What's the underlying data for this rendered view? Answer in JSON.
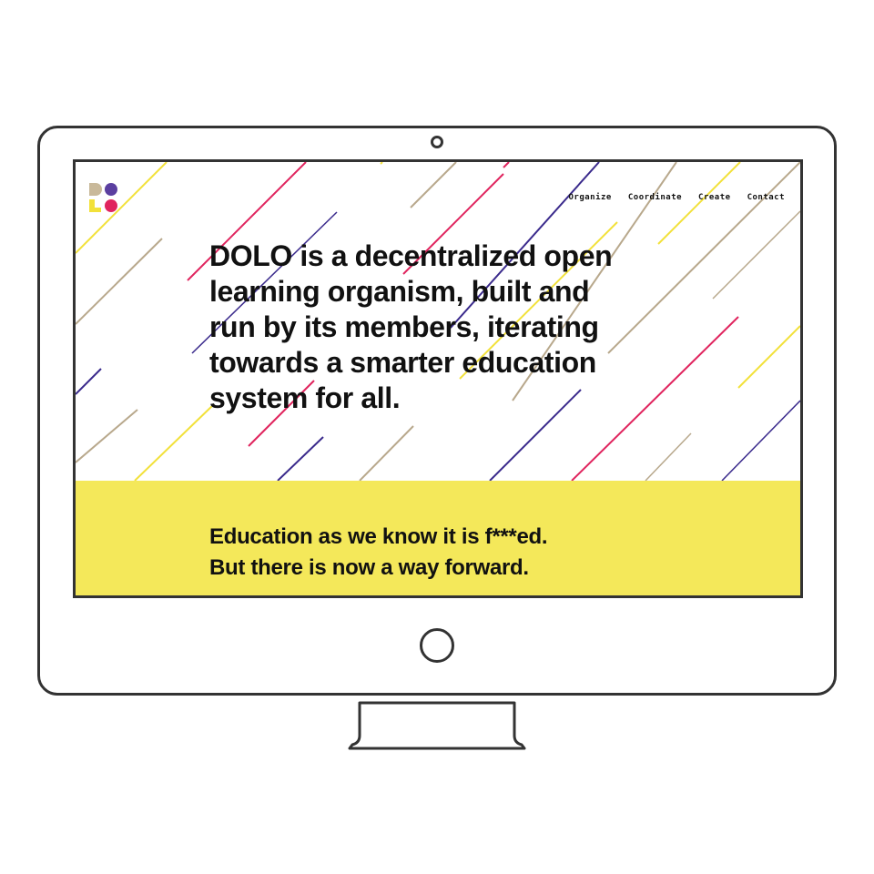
{
  "nav": {
    "items": [
      {
        "label": "Organize"
      },
      {
        "label": "Coordinate"
      },
      {
        "label": "Create"
      },
      {
        "label": "Contact"
      }
    ]
  },
  "hero": {
    "lines": [
      "DOLO is a decentralized open",
      "learning organism, built and",
      "run by its members, iterating",
      "towards a smarter education",
      "system for all."
    ]
  },
  "band": {
    "line1": "Education as we know it is f***ed.",
    "line2": "But there is now a way forward."
  },
  "colors": {
    "yellow": "#f4e85a",
    "stripe_red": "#e0245e",
    "stripe_purple": "#3a2a8c",
    "stripe_tan": "#b8a88c",
    "stripe_yellow": "#f2e13a",
    "logo_tan": "#c9b99a",
    "logo_purple": "#5b3fa0",
    "logo_pink": "#e0245e"
  },
  "icons": {
    "logo": "dolo-logo-icon",
    "camera": "camera-icon",
    "home": "home-button-icon"
  }
}
